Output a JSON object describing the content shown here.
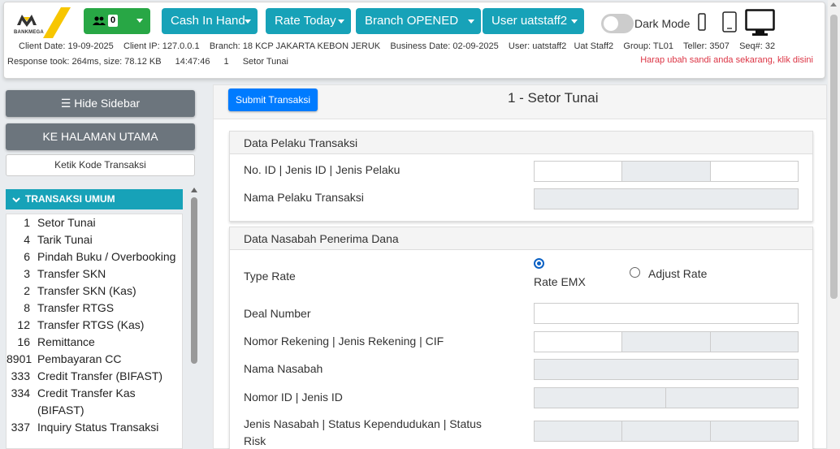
{
  "brand": {
    "name": "BANKMEGA",
    "colors": {
      "yellow": "#f7c600",
      "dark": "#333333"
    }
  },
  "header": {
    "users_badge": "0",
    "cash_in_hand": "Cash In Hand",
    "rate_today": "Rate Today",
    "branch_status": "Branch OPENED",
    "user_menu": "User uatstaff2",
    "dark_mode_label": "Dark Mode",
    "info": {
      "client_date": "Client Date: 19-09-2025",
      "client_ip": "Client IP: 127.0.0.1",
      "branch": "Branch: 18 KCP JAKARTA KEBON JERUK",
      "business_date": "Business Date: 02-09-2025",
      "user": "User: uatstaff2",
      "user_name": "Uat Staff2",
      "group": "Group: TL01",
      "teller": "Teller: 3507",
      "seq": "Seq#: 32",
      "response": "Response took: 264ms, size: 78.12 KB",
      "time": "14:47:46",
      "tx_code": "1",
      "tx_name": "Setor Tunai"
    },
    "warning": "Harap ubah sandi anda sekarang, klik disini"
  },
  "sidebar": {
    "hide_label": "☰ Hide Sidebar",
    "home_label": "KE HALAMAN UTAMA",
    "kode_placeholder": "Ketik Kode Transaksi",
    "group_label": "TRANSAKSI UMUM",
    "items": [
      {
        "code": "1",
        "label": "Setor Tunai"
      },
      {
        "code": "4",
        "label": "Tarik Tunai"
      },
      {
        "code": "6",
        "label": "Pindah Buku / Overbooking"
      },
      {
        "code": "3",
        "label": "Transfer SKN"
      },
      {
        "code": "2",
        "label": "Transfer SKN (Kas)"
      },
      {
        "code": "8",
        "label": "Transfer RTGS"
      },
      {
        "code": "12",
        "label": "Transfer RTGS (Kas)"
      },
      {
        "code": "16",
        "label": "Remittance"
      },
      {
        "code": "8901",
        "label": "Pembayaran CC"
      },
      {
        "code": "333",
        "label": "Credit Transfer (BIFAST)"
      },
      {
        "code": "334",
        "label": "Credit Transfer Kas (BIFAST)"
      },
      {
        "code": "337",
        "label": "Inquiry Status Transaksi"
      }
    ]
  },
  "main": {
    "submit_label": "Submit Transaksi",
    "title": "1 - Setor Tunai",
    "pelaku": {
      "title": "Data Pelaku Transaksi",
      "no_id_label": "No. ID | Jenis ID | Jenis Pelaku",
      "nama_label": "Nama Pelaku Transaksi"
    },
    "nasabah": {
      "title": "Data Nasabah Penerima Dana",
      "type_rate_label": "Type Rate",
      "rate_emx": "Rate EMX",
      "adjust_rate": "Adjust Rate",
      "deal_number_label": "Deal Number",
      "rekening_label": "Nomor Rekening | Jenis Rekening | CIF",
      "nama_label": "Nama Nasabah",
      "nomor_id_label": "Nomor ID | Jenis ID",
      "jenis_label": "Jenis Nasabah | Status Kependudukan | Status Risk"
    }
  }
}
